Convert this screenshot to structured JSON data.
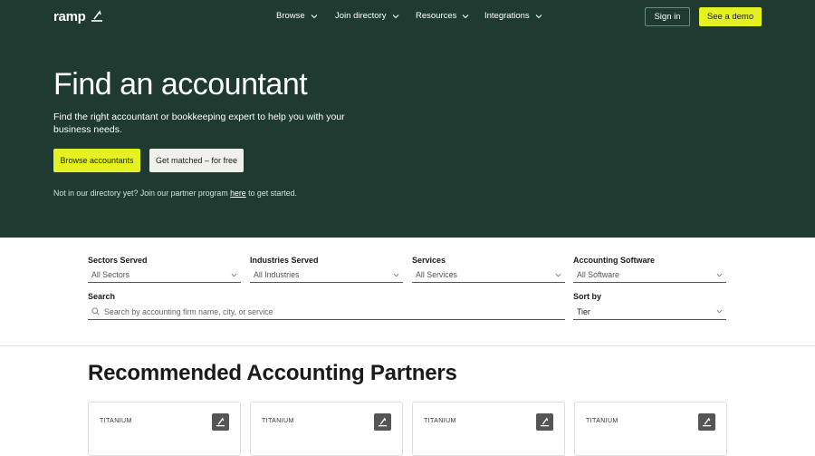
{
  "brand": {
    "name": "ramp"
  },
  "nav": {
    "items": [
      {
        "label": "Browse"
      },
      {
        "label": "Join directory"
      },
      {
        "label": "Resources"
      },
      {
        "label": "Integrations"
      }
    ],
    "sign_in": "Sign in",
    "demo": "See a demo"
  },
  "hero": {
    "title": "Find an accountant",
    "subtitle": "Find the right accountant or bookkeeping expert to help you with your business needs.",
    "browse_button": "Browse accountants",
    "match_button": "Get matched – for free",
    "partner_prefix": "Not in our directory yet? Join our partner program ",
    "partner_link": "here",
    "partner_suffix": " to get started."
  },
  "filters": {
    "sectors": {
      "label": "Sectors Served",
      "value": "All Sectors"
    },
    "industries": {
      "label": "Industries Served",
      "value": "All Industries"
    },
    "services": {
      "label": "Services",
      "value": "All Services"
    },
    "software": {
      "label": "Accounting Software",
      "value": "All Software"
    },
    "search": {
      "label": "Search",
      "placeholder": "Search by accounting firm name, city, or service"
    },
    "sort": {
      "label": "Sort by",
      "value": "Tier"
    }
  },
  "recommended": {
    "title": "Recommended Accounting Partners",
    "cards": [
      {
        "tier": "TITANIUM"
      },
      {
        "tier": "TITANIUM"
      },
      {
        "tier": "TITANIUM"
      },
      {
        "tier": "TITANIUM"
      }
    ]
  },
  "colors": {
    "hero_bg": "#1e3a31",
    "accent_yellow": "#e4f222",
    "secondary_button": "#f1f1ec"
  }
}
